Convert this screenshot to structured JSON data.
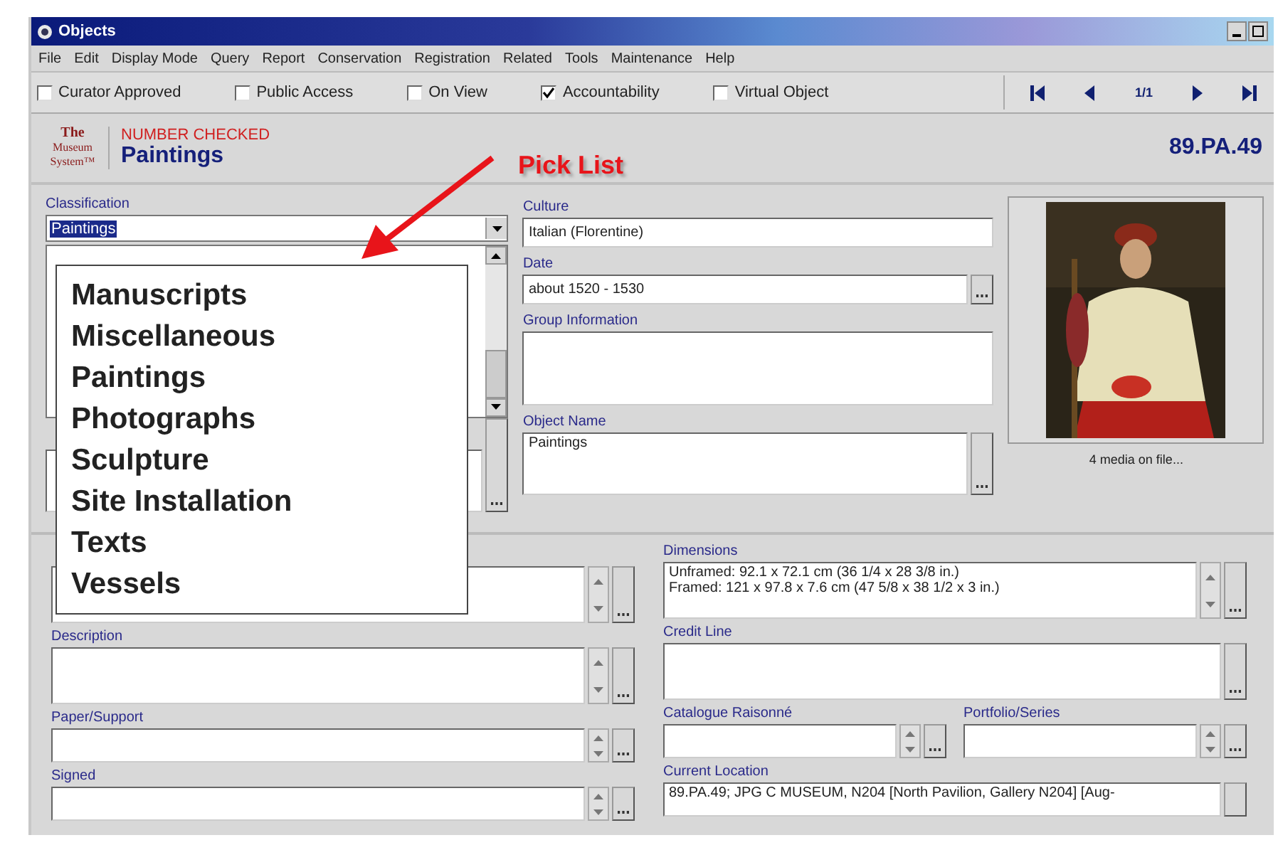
{
  "window": {
    "title": "Objects"
  },
  "menu": [
    "File",
    "Edit",
    "Display Mode",
    "Query",
    "Report",
    "Conservation",
    "Registration",
    "Related",
    "Tools",
    "Maintenance",
    "Help"
  ],
  "flags": [
    {
      "label": "Curator Approved",
      "checked": false
    },
    {
      "label": "Public Access",
      "checked": false
    },
    {
      "label": "On View",
      "checked": false
    },
    {
      "label": "Accountability",
      "checked": true
    },
    {
      "label": "Virtual Object",
      "checked": false
    }
  ],
  "navigator": {
    "position": "1/1"
  },
  "header": {
    "logo": [
      "The",
      "Museum",
      "System™"
    ],
    "status": "NUMBER CHECKED",
    "title": "Paintings",
    "object_number": "89.PA.49"
  },
  "annotation": {
    "label": "Pick List"
  },
  "classification": {
    "label": "Classification",
    "value": "Paintings"
  },
  "pick_list": [
    "Manuscripts",
    "Miscellaneous",
    "Paintings",
    "Photographs",
    "Sculpture",
    "Site Installation",
    "Texts",
    "Vessels"
  ],
  "upper_fields": [
    {
      "kind": "text",
      "label": "Culture",
      "value": "Italian (Florentine)"
    },
    {
      "kind": "lookup",
      "label": "Date",
      "value": "about 1520 - 1530"
    },
    {
      "kind": "memo",
      "label": "Group Information"
    },
    {
      "kind": "lookup_memo",
      "label": "Object Name",
      "value": "Paintings"
    }
  ],
  "media": {
    "caption": "4 media on file..."
  },
  "lower_left": [
    {
      "kind": "spin"
    },
    {
      "kind": "spin_tall",
      "label": "Description"
    },
    {
      "kind": "spin",
      "label": "Paper/Support"
    },
    {
      "kind": "spin",
      "label": "Signed"
    }
  ],
  "lower_right": {
    "dimensions": {
      "label": "Dimensions",
      "lines": [
        "Unframed: 92.1 x 72.1 cm (36 1/4 x 28 3/8 in.)",
        "Framed: 121 x 97.8 x 7.6 cm (47 5/8 x 38 1/2 x 3 in.)"
      ]
    },
    "credit_line": {
      "label": "Credit Line"
    },
    "catalogue": {
      "label": "Catalogue Raisonné"
    },
    "portfolio": {
      "label": "Portfolio/Series"
    },
    "location": {
      "label": "Current Location",
      "value": "89.PA.49; JPG C MUSEUM, N204 [North Pavilion, Gallery N204] [Aug-"
    }
  }
}
